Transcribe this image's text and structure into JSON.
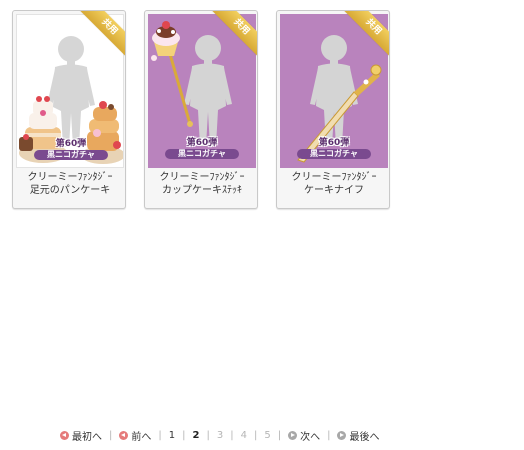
{
  "items": [
    {
      "caption_line1": "クリーミーﾌｧﾝﾀｼﾞｰ",
      "caption_line2": "足元のパンケーキ",
      "badge": "共用",
      "stamp_line1": "第60弾",
      "stamp_line2": "黒ニコガチャ"
    },
    {
      "caption_line1": "クリーミーﾌｧﾝﾀｼﾞｰ",
      "caption_line2": "カップケーキｽﾃｯｷ",
      "badge": "共用",
      "stamp_line1": "第60弾",
      "stamp_line2": "黒ニコガチャ"
    },
    {
      "caption_line1": "クリーミーﾌｧﾝﾀｼﾞｰ",
      "caption_line2": "ケーキナイフ",
      "badge": "共用",
      "stamp_line1": "第60弾",
      "stamp_line2": "黒ニコガチャ"
    }
  ],
  "pagination": {
    "first": "最初へ",
    "prev": "前へ",
    "pages": [
      "1",
      "2",
      "3",
      "4",
      "5"
    ],
    "current_page": "2",
    "next": "次へ",
    "last": "最後へ"
  },
  "colors": {
    "purple_bg": "#b983bd",
    "badge_gold": "#e2bb4a",
    "prev_icon": "#e57b7b",
    "next_icon": "#a8a8a8"
  }
}
